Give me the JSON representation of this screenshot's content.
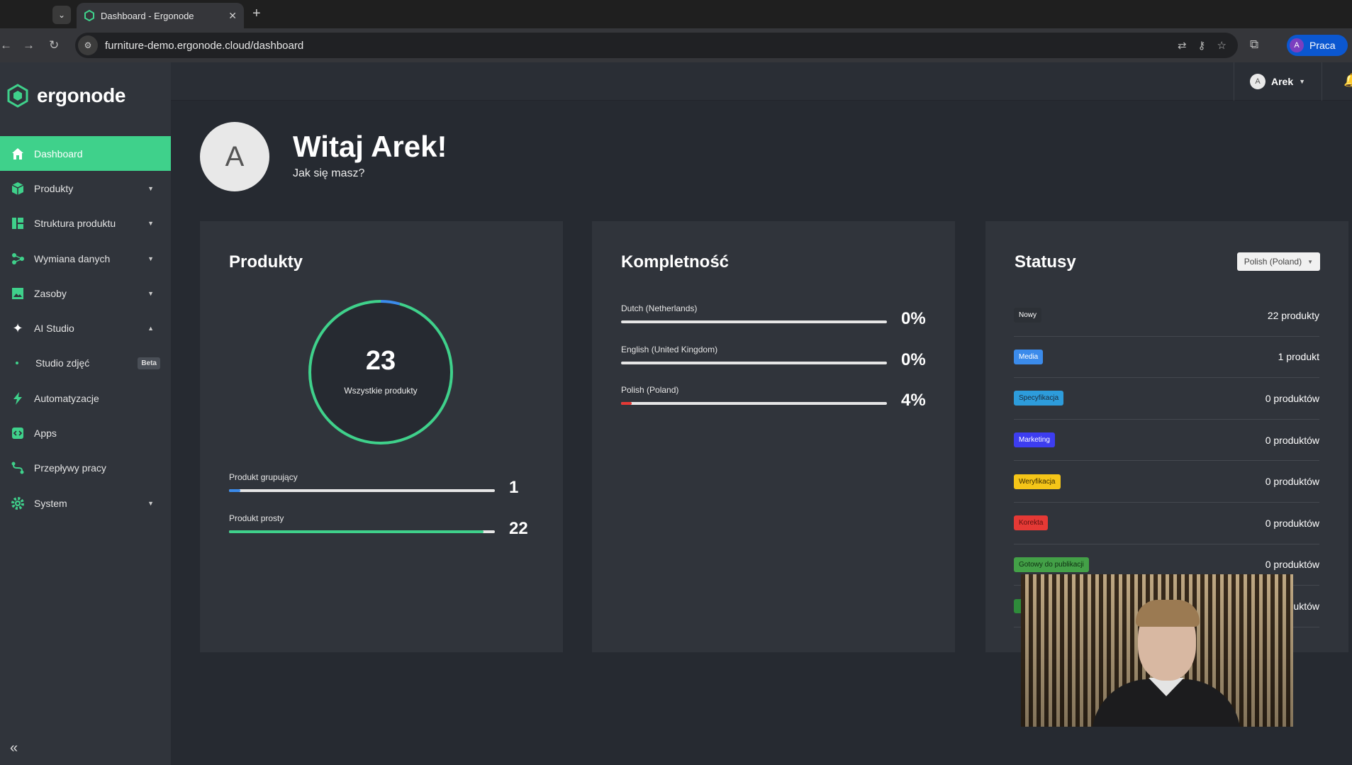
{
  "browser": {
    "tab_title": "Dashboard - Ergonode",
    "url": "furniture-demo.ergonode.cloud/dashboard",
    "profile_initial": "A",
    "profile_label": "Praca"
  },
  "app": {
    "logo_text": "ergonode",
    "brand_color": "#3fd18b"
  },
  "sidebar": {
    "items": [
      {
        "label": "Dashboard",
        "icon": "home-icon",
        "active": true
      },
      {
        "label": "Produkty",
        "icon": "cube-icon",
        "expandable": true
      },
      {
        "label": "Struktura produktu",
        "icon": "structure-icon",
        "expandable": true
      },
      {
        "label": "Wymiana danych",
        "icon": "share-icon",
        "expandable": true
      },
      {
        "label": "Zasoby",
        "icon": "image-icon",
        "expandable": true
      },
      {
        "label": "AI Studio",
        "icon": "sparkle-icon",
        "expanded": true
      },
      {
        "label": "Studio zdjęć",
        "badge": "Beta",
        "sub": true
      },
      {
        "label": "Automatyzacje",
        "icon": "bolt-icon"
      },
      {
        "label": "Apps",
        "icon": "apps-icon"
      },
      {
        "label": "Przepływy pracy",
        "icon": "workflow-icon"
      },
      {
        "label": "System",
        "icon": "gear-icon",
        "expandable": true
      }
    ]
  },
  "header": {
    "user_initial": "A",
    "user_name": "Arek"
  },
  "greeting": {
    "avatar_initial": "A",
    "title": "Witaj Arek!",
    "subtitle": "Jak się masz?"
  },
  "products_card": {
    "title": "Produkty",
    "total": "23",
    "total_label": "Wszystkie produkty",
    "rows": [
      {
        "label": "Produkt grupujący",
        "value": "1",
        "fraction": 0.043,
        "color": "#3b8beb"
      },
      {
        "label": "Produkt prosty",
        "value": "22",
        "fraction": 0.957,
        "color": "#3fd18b"
      }
    ]
  },
  "completeness_card": {
    "title": "Kompletność",
    "rows": [
      {
        "label": "Dutch (Netherlands)",
        "value": "0%",
        "fraction": 0
      },
      {
        "label": "English (United Kingdom)",
        "value": "0%",
        "fraction": 0
      },
      {
        "label": "Polish (Poland)",
        "value": "4%",
        "fraction": 0.04,
        "color": "#e53935"
      }
    ]
  },
  "status_card": {
    "title": "Statusy",
    "language_select": "Polish (Poland)",
    "rows": [
      {
        "badge": "Nowy",
        "count": "22 produkty",
        "bg": "#2c3036",
        "fg": "#ffffff"
      },
      {
        "badge": "Media",
        "count": "1 produkt",
        "bg": "#3b8beb",
        "fg": "#ffffff"
      },
      {
        "badge": "Specyfikacja",
        "count": "0 produktów",
        "bg": "#2d9cdb",
        "fg": "#1b2a3a"
      },
      {
        "badge": "Marketing",
        "count": "0 produktów",
        "bg": "#3d3df0",
        "fg": "#ffffff"
      },
      {
        "badge": "Weryfikacja",
        "count": "0 produktów",
        "bg": "#f5c518",
        "fg": "#3a2a00"
      },
      {
        "badge": "Korekta",
        "count": "0 produktów",
        "bg": "#e53935",
        "fg": "#5a1010"
      },
      {
        "badge": "Gotowy do publikacji",
        "count": "0 produktów",
        "bg": "#43a047",
        "fg": "#0f2e12"
      },
      {
        "badge": "",
        "count": "uktów",
        "bg": "#2e8b3a",
        "fg": "#ffffff"
      }
    ]
  }
}
